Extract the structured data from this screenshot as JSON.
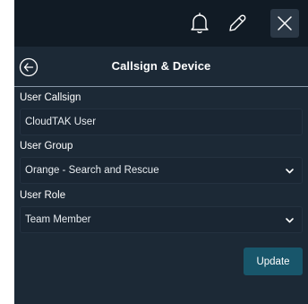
{
  "window": {
    "icons": [
      "bell-icon",
      "pencil-icon",
      "close-icon"
    ]
  },
  "header": {
    "title": "Callsign & Device",
    "back_icon": "circle-arrow-left-icon"
  },
  "form": {
    "callsign": {
      "label": "User Callsign",
      "value": "CloudTAK User"
    },
    "group": {
      "label": "User Group",
      "selected": "Orange - Search and Rescue"
    },
    "role": {
      "label": "User Role",
      "selected": "Team Member"
    },
    "update_label": "Update"
  },
  "colors": {
    "panel": "#1c2936",
    "topbar": "#111b25",
    "field": "#1a2633",
    "button": "#18566b",
    "divider": "#8796a6"
  }
}
